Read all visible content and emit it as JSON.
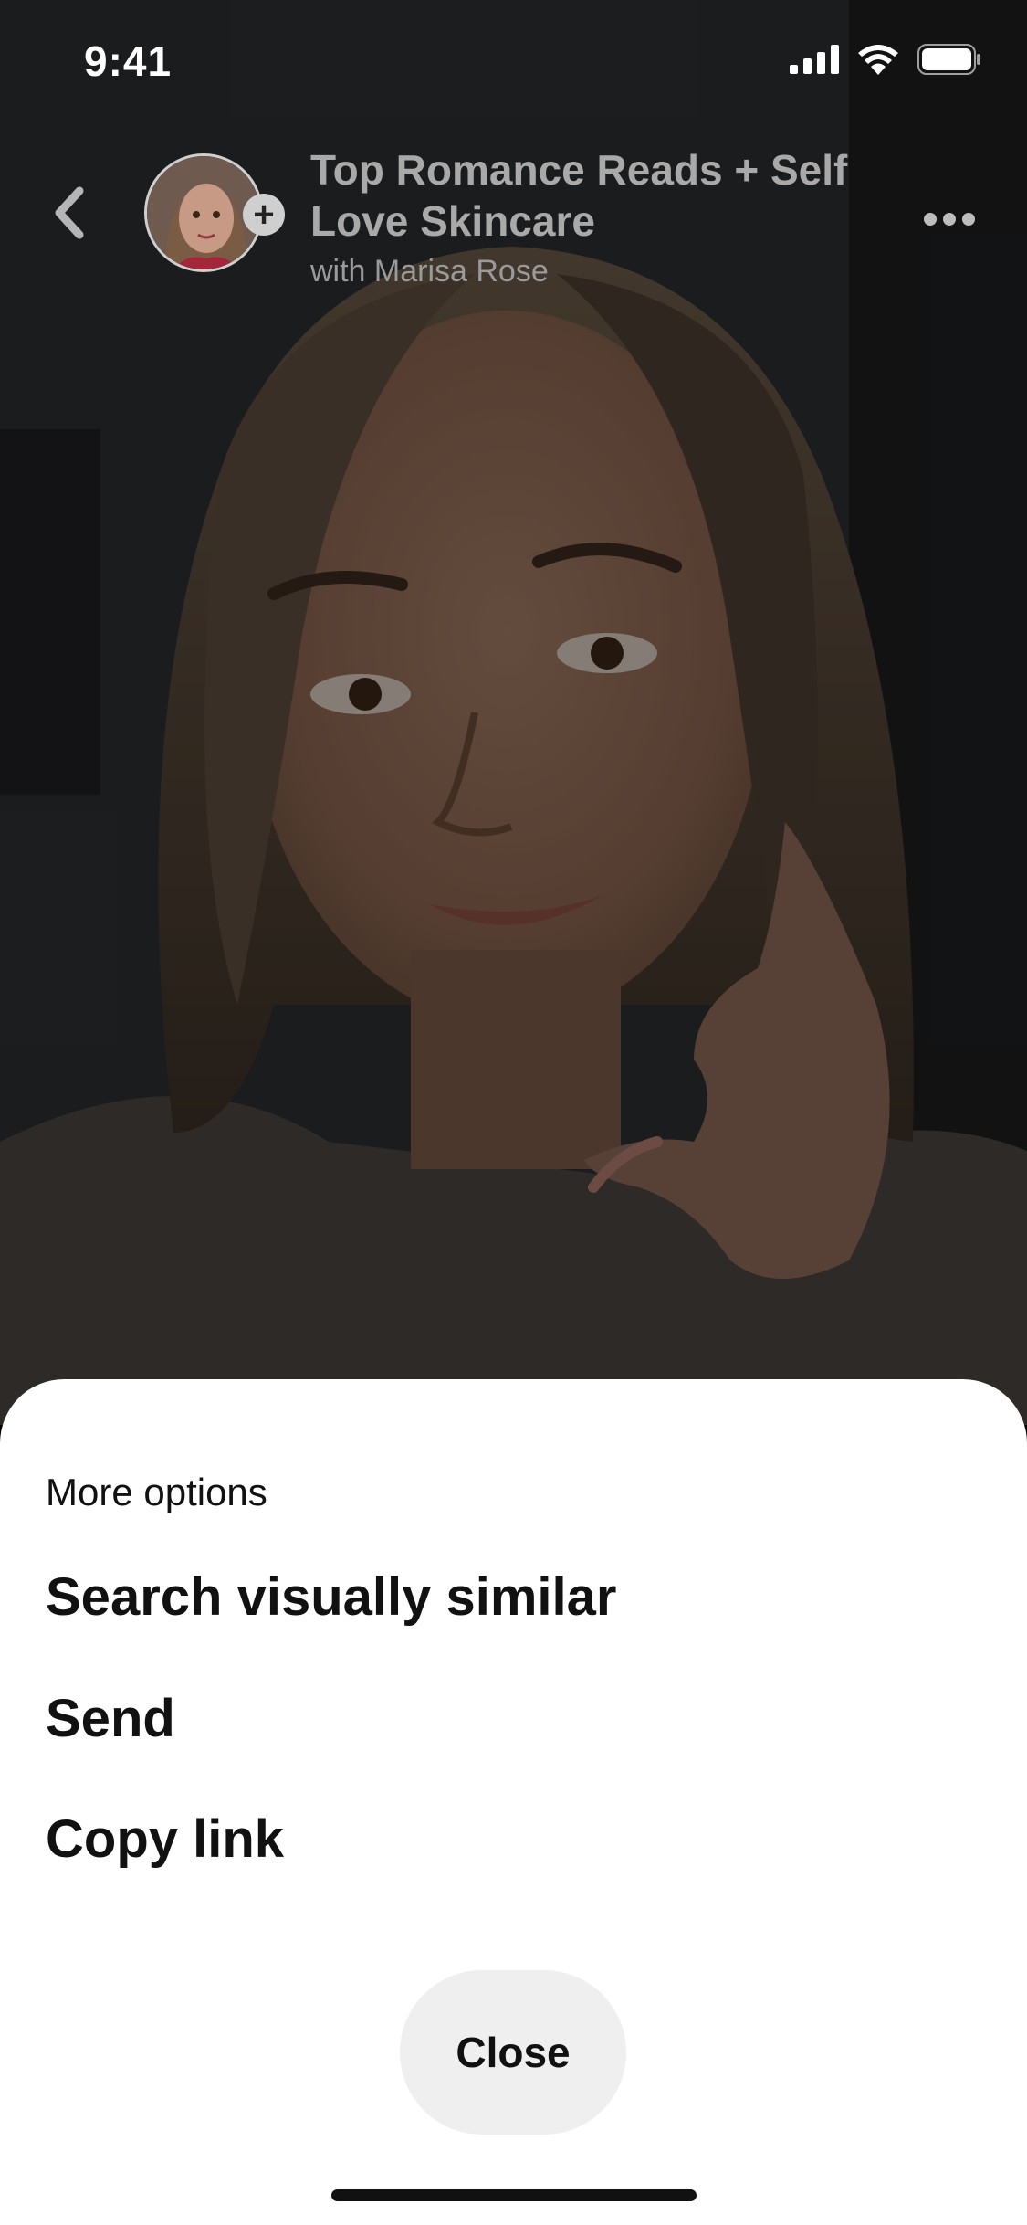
{
  "status_bar": {
    "time": "9:41",
    "icons": [
      "cellular-signal-icon",
      "wifi-icon",
      "battery-icon"
    ]
  },
  "header": {
    "back_icon": "chevron-left-icon",
    "title": "Top Romance Reads + Self Love Skincare",
    "subtitle": "with Marisa Rose",
    "avatar_plus": "+",
    "more_icon": "more-horizontal-icon"
  },
  "sheet": {
    "heading": "More options",
    "options": [
      {
        "label": "Search visually similar"
      },
      {
        "label": "Send"
      },
      {
        "label": "Copy link"
      }
    ],
    "close_label": "Close"
  },
  "colors": {
    "sheet_background": "#ffffff",
    "close_button_background": "#efefef",
    "header_text": "#a9a9a9",
    "option_text": "#111111"
  }
}
